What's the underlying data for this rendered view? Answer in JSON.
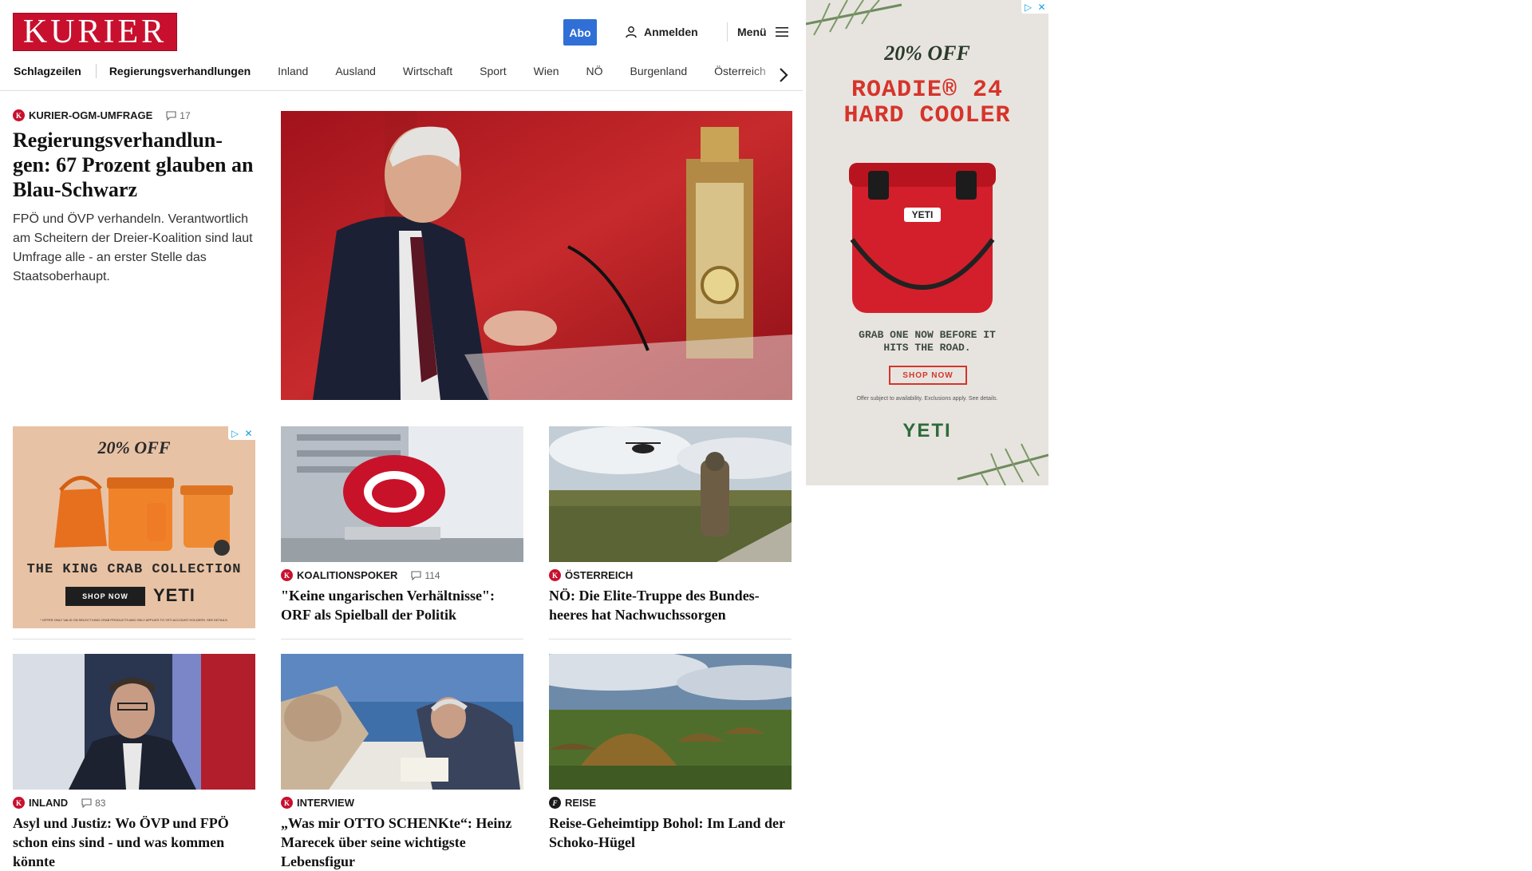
{
  "brand": {
    "logo": "KURIER"
  },
  "header": {
    "abo_label": "Abo",
    "login_label": "Anmelden",
    "menu_label": "Menü"
  },
  "nav": {
    "items": [
      "Schlagzeilen",
      "Regierungsverhandlungen",
      "Inland",
      "Ausland",
      "Wirtschaft",
      "Sport",
      "Wien",
      "NÖ",
      "Burgenland",
      "Österreich"
    ]
  },
  "lead": {
    "kicker": "KURIER-OGM-UMFRAGE",
    "comments": "17",
    "headline": "Regierungsverhandlun-gen: 67 Prozent glauben an Blau-Schwarz",
    "teaser": "FPÖ und ÖVP verhandeln. Verantwortlich am Scheitern der Dreier-Koalition sind laut Umfrage alle - an erster Stelle das Staatsoberhaupt."
  },
  "cards": [
    {
      "kicker": "KOALITIONSPOKER",
      "comments": "114",
      "headline": "\"Keine ungarischen Verhältnisse\": ORF als Spielball der Politik"
    },
    {
      "kicker": "ÖSTERREICH",
      "comments": "",
      "headline": "NÖ: Die Elite-Truppe des Bundes-heeres hat Nachwuchssorgen"
    },
    {
      "kicker": "INLAND",
      "comments": "83",
      "headline": "Asyl und Justiz: Wo ÖVP und FPÖ schon eins sind - und was kommen könnte"
    },
    {
      "kicker": "INTERVIEW",
      "comments": "",
      "headline": "„Was mir OTTO SCHENKte“: Heinz Marecek über seine wichtigste Lebensfigur"
    },
    {
      "kicker": "REISE",
      "comments": "",
      "headline": "Reise-Geheimtipp Bohol: Im Land der Schoko-Hügel"
    }
  ],
  "ad_tile": {
    "offer": "20% OFF",
    "headline": "THE KING CRAB COLLECTION",
    "cta": "SHOP NOW",
    "brand": "YETI",
    "disclaimer": "* OFFER ONLY VALID ON SELECT KING CRAB PRODUCTS AND ONLY APPLIES TO YETI ACCOUNT HOLDERS. SEE DETAILS."
  },
  "ad_side": {
    "offer": "20% OFF",
    "product_line1": "ROADIE® 24",
    "product_line2": "HARD COOLER",
    "tagline": "GRAB ONE NOW BEFORE IT HITS THE ROAD.",
    "cta": "SHOP NOW",
    "fineprint": "Offer subject to availability. Exclusions apply. See details.",
    "brand": "YETI",
    "product_badge": "YETI"
  },
  "colors": {
    "brand_red": "#c8102e",
    "abo_blue": "#2f6fd6",
    "yeti_green": "#2e6b3a",
    "ad_orange": "#e8c4a8"
  },
  "icons": [
    "user-icon",
    "hamburger-menu-icon",
    "chevron-right-icon",
    "comment-icon",
    "adchoices-icon",
    "close-icon"
  ]
}
